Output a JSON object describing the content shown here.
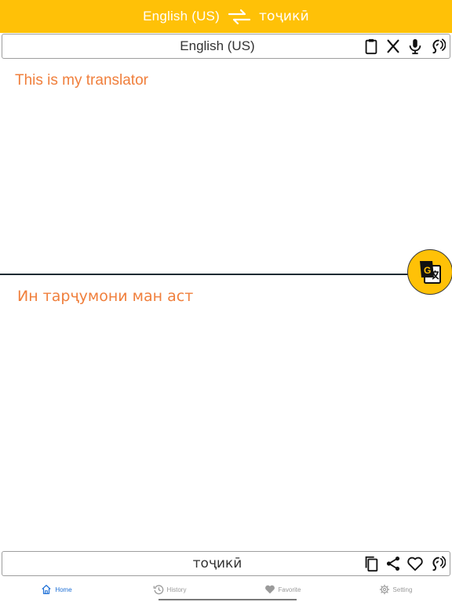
{
  "header": {
    "source_lang": "English (US)",
    "target_lang": "тоҷикӣ",
    "swap_icon": "swap-arrows-icon"
  },
  "source": {
    "lang_label": "English (US)",
    "text": "This is my translator",
    "icons": [
      "clipboard-icon",
      "clear-icon",
      "microphone-icon",
      "speaker-icon"
    ]
  },
  "target": {
    "lang_label": "тоҷикӣ",
    "text": "Ин тарҷумони ман аст",
    "icons": [
      "copy-icon",
      "share-icon",
      "favorite-icon",
      "speaker-icon"
    ]
  },
  "translate_button": {
    "icon": "google-translate-icon"
  },
  "tabs": [
    {
      "label": "Home",
      "icon": "home-icon",
      "active": true
    },
    {
      "label": "History",
      "icon": "history-icon",
      "active": false
    },
    {
      "label": "Favorite",
      "icon": "heart-icon",
      "active": false
    },
    {
      "label": "Setting",
      "icon": "gear-icon",
      "active": false
    }
  ],
  "colors": {
    "accent": "#FFC107",
    "text_orange": "#F07F3C",
    "active_tab": "#1D6FD6",
    "divider": "#1D2B33"
  }
}
